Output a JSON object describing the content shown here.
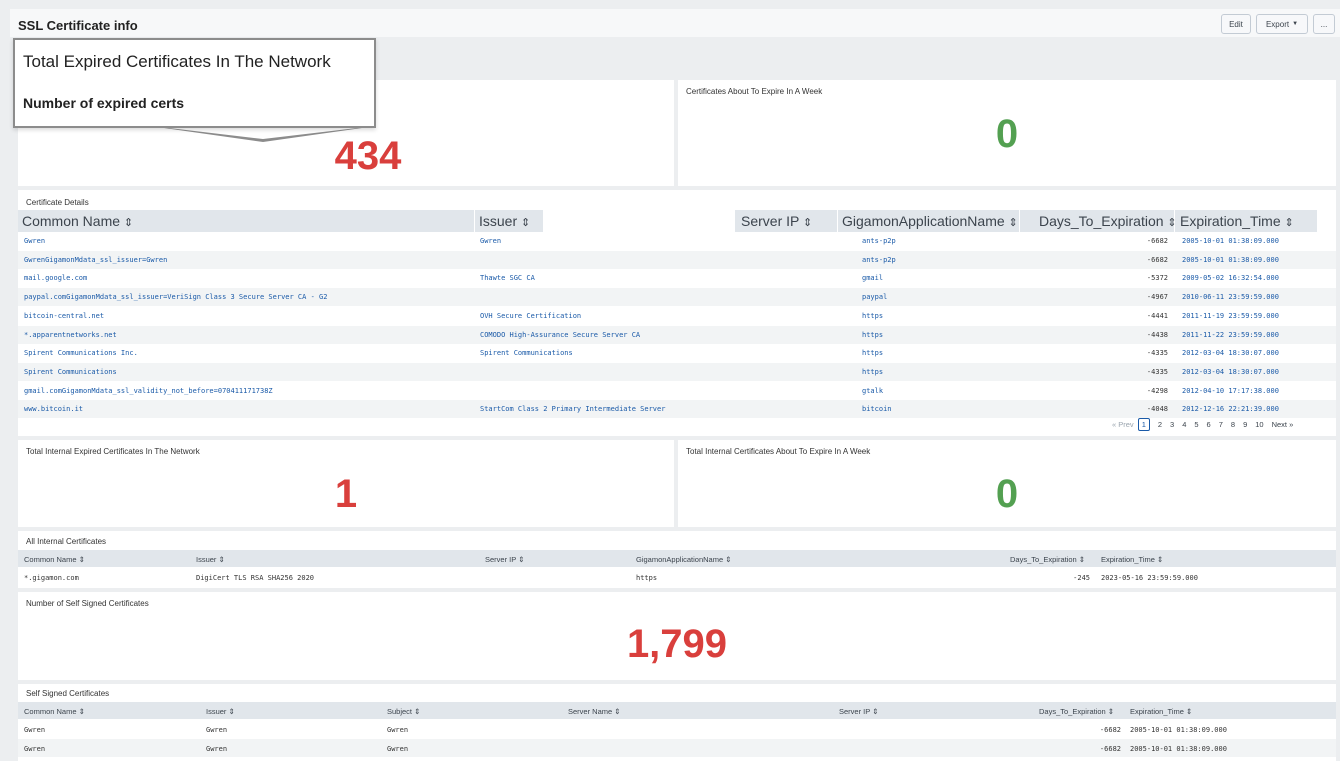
{
  "dashboard": {
    "title": "SSL Certificate info",
    "edit_label": "Edit",
    "export_label": "Export",
    "more_label": "...",
    "caret": "▼"
  },
  "tooltip": {
    "title": "Total Expired Certificates In The Network",
    "subtitle": "Number of expired certs"
  },
  "expired": {
    "value": "434"
  },
  "week": {
    "title": "Certificates About To Expire In A Week",
    "value": "0"
  },
  "details": {
    "title": "Certificate Details",
    "headers": [
      "Common Name",
      "Issuer",
      "Server IP",
      "GigamonApplicationName",
      "Days_To_Expiration",
      "Expiration_Time"
    ],
    "sort_glyph": "⇕",
    "rows": [
      {
        "cn": "Gwren",
        "issuer": "Gwren",
        "ip": "",
        "app": "ants-p2p",
        "days": "-6682",
        "time": "2005-10-01 01:38:09.000"
      },
      {
        "cn": "GwrenGigamonMdata_ssl_issuer=Gwren",
        "issuer": "",
        "ip": "",
        "app": "ants-p2p",
        "days": "-6682",
        "time": "2005-10-01 01:38:09.000"
      },
      {
        "cn": "mail.google.com",
        "issuer": "Thawte SGC CA",
        "ip": "",
        "app": "gmail",
        "days": "-5372",
        "time": "2009-05-02 16:32:54.000"
      },
      {
        "cn": "paypal.comGigamonMdata_ssl_issuer=VeriSign Class 3 Secure Server CA - G2",
        "issuer": "",
        "ip": "",
        "app": "paypal",
        "days": "-4967",
        "time": "2010-06-11 23:59:59.000"
      },
      {
        "cn": "bitcoin-central.net",
        "issuer": "OVH Secure Certification",
        "ip": "",
        "app": "https",
        "days": "-4441",
        "time": "2011-11-19 23:59:59.000"
      },
      {
        "cn": "*.apparentnetworks.net",
        "issuer": "COMODO High-Assurance Secure Server CA",
        "ip": "",
        "app": "https",
        "days": "-4438",
        "time": "2011-11-22 23:59:59.000"
      },
      {
        "cn": "Spirent Communications Inc.",
        "issuer": "Spirent Communications",
        "ip": "",
        "app": "https",
        "days": "-4335",
        "time": "2012-03-04 18:30:07.000"
      },
      {
        "cn": "Spirent Communications",
        "issuer": "",
        "ip": "",
        "app": "https",
        "days": "-4335",
        "time": "2012-03-04 18:30:07.000"
      },
      {
        "cn": "gmail.comGigamonMdata_ssl_validity_not_before=070411171738Z",
        "issuer": "",
        "ip": "",
        "app": "gtalk",
        "days": "-4298",
        "time": "2012-04-10 17:17:38.000"
      },
      {
        "cn": "www.bitcoin.it",
        "issuer": "StartCom Class 2 Primary Intermediate Server",
        "ip": "",
        "app": "bitcoin",
        "days": "-4048",
        "time": "2012-12-16 22:21:39.000"
      }
    ],
    "pager": {
      "prev": "« Prev",
      "pages": [
        "1",
        "2",
        "3",
        "4",
        "5",
        "6",
        "7",
        "8",
        "9",
        "10"
      ],
      "next": "Next »"
    }
  },
  "internal_expired": {
    "title": "Total Internal Expired Certificates In The Network",
    "value": "1"
  },
  "internal_week": {
    "title": "Total Internal Certificates About To Expire In A Week",
    "value": "0"
  },
  "internal": {
    "title": "All Internal Certificates",
    "headers": [
      "Common Name",
      "Issuer",
      "Server IP",
      "GigamonApplicationName",
      "Days_To_Expiration",
      "Expiration_Time"
    ],
    "row": {
      "cn": "*.gigamon.com",
      "issuer": "DigiCert TLS RSA SHA256 2020",
      "ip": "",
      "app": "https",
      "days": "-245",
      "time": "2023-05-16 23:59:59.000"
    }
  },
  "selfsigned_count": {
    "title": "Number of Self Signed Certificates",
    "value": "1,799"
  },
  "selfsigned": {
    "title": "Self Signed Certificates",
    "headers": [
      "Common Name",
      "Issuer",
      "Subject",
      "Server Name",
      "Server IP",
      "Days_To_Expiration",
      "Expiration_Time"
    ],
    "rows": [
      {
        "cn": "Gwren",
        "issuer": "Gwren",
        "subject": "Gwren",
        "name": "",
        "ip": "",
        "days": "-6682",
        "time": "2005-10-01 01:38:09.000"
      },
      {
        "cn": "Gwren",
        "issuer": "Gwren",
        "subject": "Gwren",
        "name": "",
        "ip": "",
        "days": "-6682",
        "time": "2005-10-01 01:38:09.000"
      }
    ]
  },
  "colors": {
    "bad": "#d93f3c",
    "good": "#53a051",
    "link": "#1a5aa8"
  }
}
